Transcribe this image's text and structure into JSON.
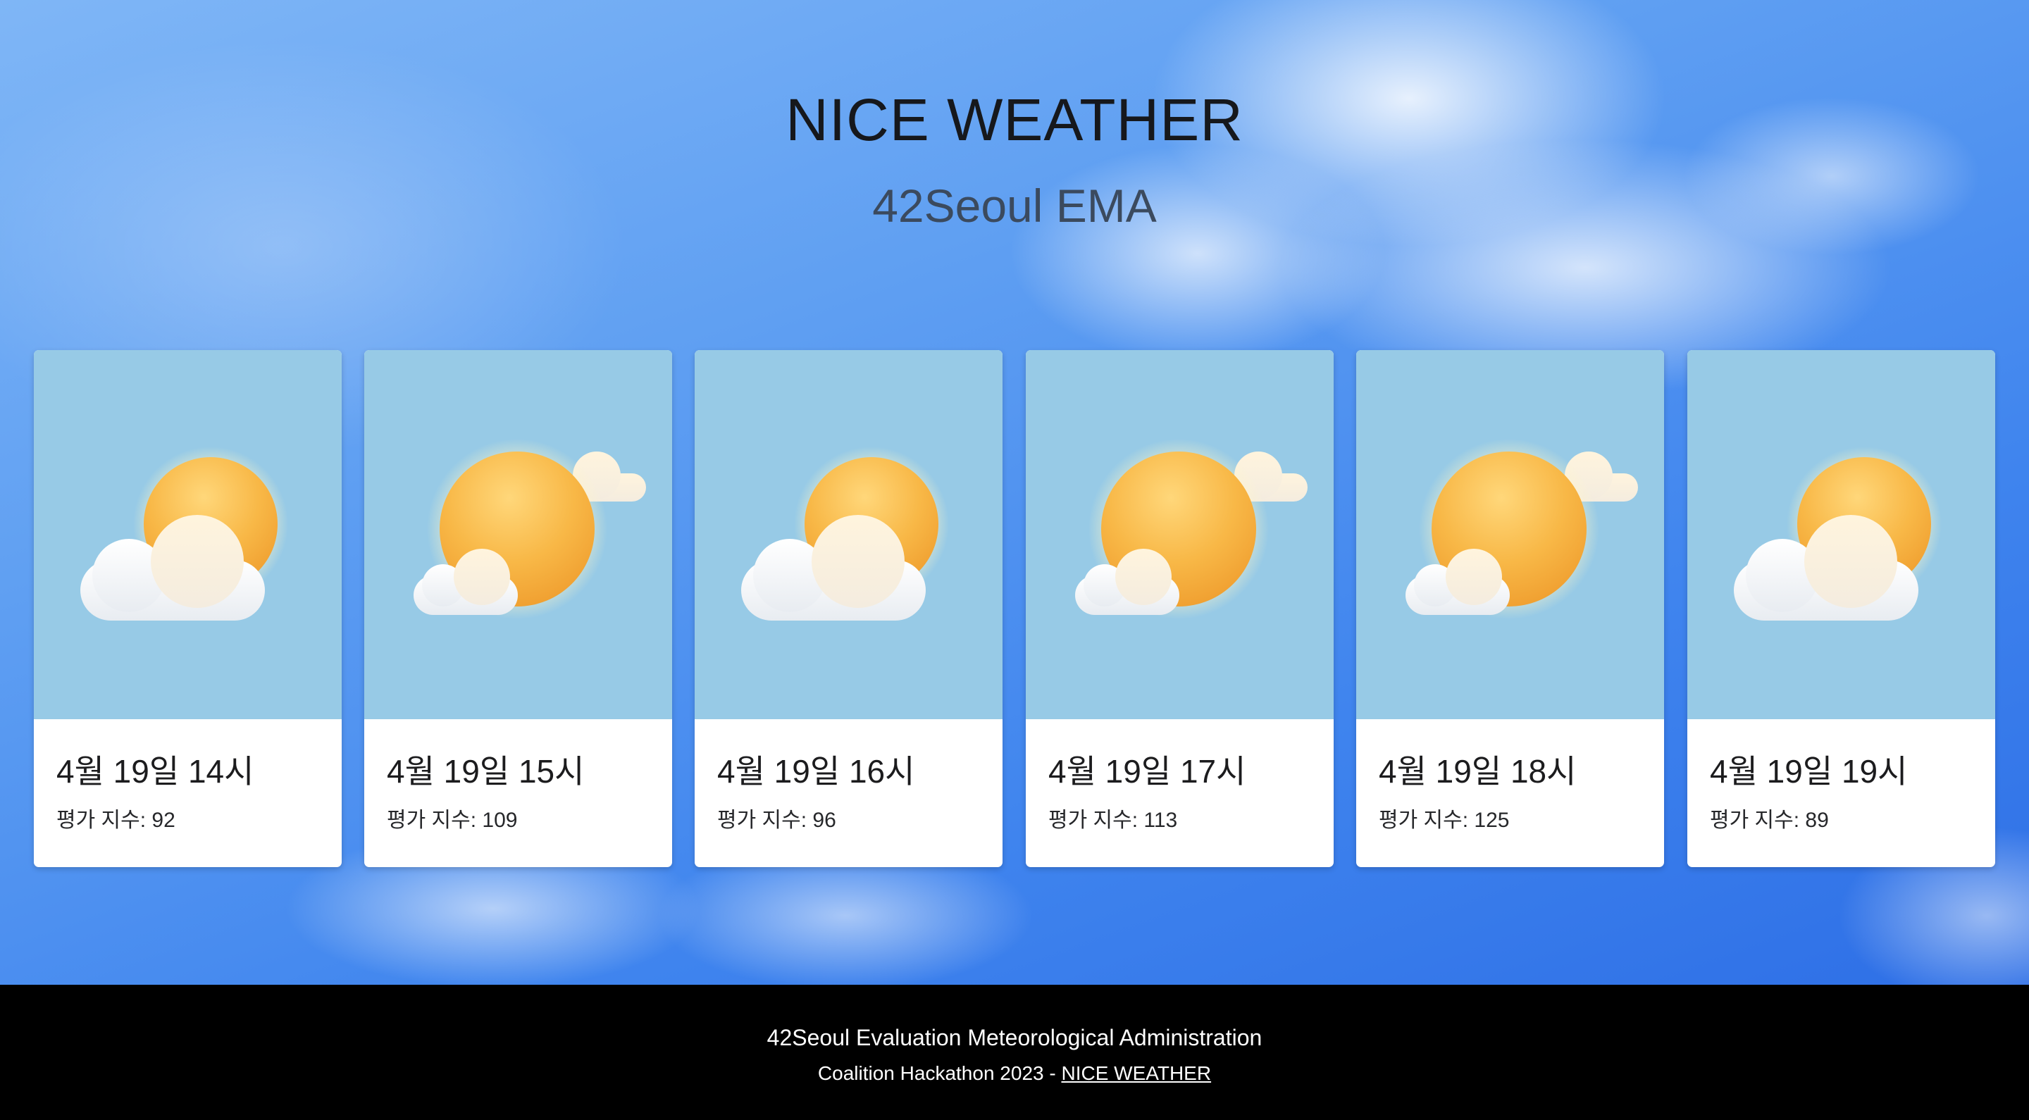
{
  "header": {
    "title": "NICE WEATHER",
    "subtitle": "42Seoul EMA"
  },
  "cards": [
    {
      "time": "4월 19일 14시",
      "score": "평가 지수: 92",
      "icon": "sun-behind-cloud-icon"
    },
    {
      "time": "4월 19일 15시",
      "score": "평가 지수: 109",
      "icon": "sun-with-small-clouds-icon"
    },
    {
      "time": "4월 19일 16시",
      "score": "평가 지수: 96",
      "icon": "sun-behind-cloud-icon"
    },
    {
      "time": "4월 19일 17시",
      "score": "평가 지수: 113",
      "icon": "sun-with-small-clouds-icon"
    },
    {
      "time": "4월 19일 18시",
      "score": "평가 지수: 125",
      "icon": "sun-with-small-clouds-icon"
    },
    {
      "time": "4월 19일 19시",
      "score": "평가 지수: 89",
      "icon": "sun-behind-cloud-icon"
    }
  ],
  "footer": {
    "line1": "42Seoul Evaluation Meteorological Administration",
    "line2_prefix": "Coalition Hackathon 2023 - ",
    "line2_link": "NICE WEATHER"
  },
  "colors": {
    "card_media_bg": "#97cae6",
    "sun": "#f7b84a",
    "footer_bg": "#000000"
  }
}
